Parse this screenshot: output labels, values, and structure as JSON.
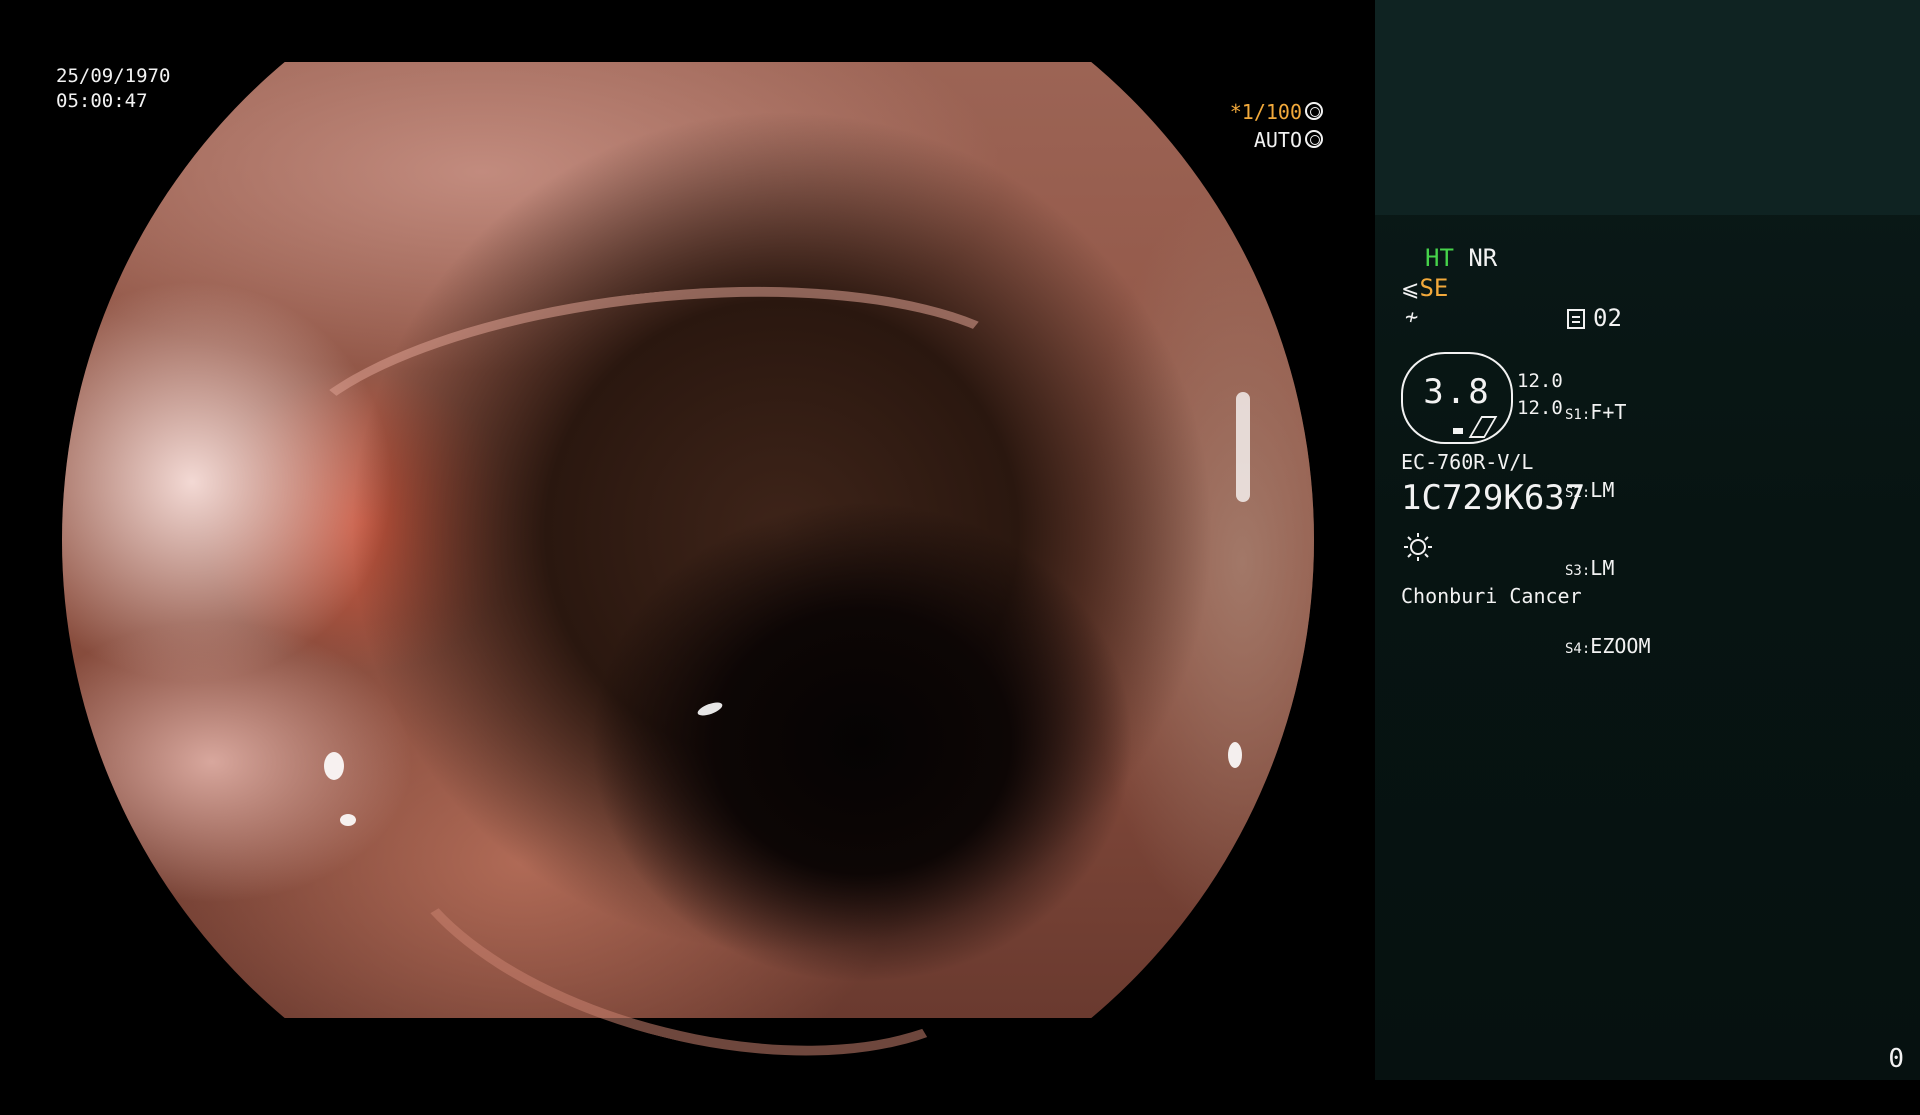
{
  "overlay": {
    "date": "25/09/1970",
    "time": "05:00:47",
    "shutter_speed": "*1/100",
    "iris_mode": "AUTO"
  },
  "panel": {
    "mode_ht": "HT",
    "mode_nr": "NR",
    "mode_se": "SE",
    "channel": "02",
    "gauge_value": "3.8",
    "gauge_side_1": "12.0",
    "gauge_side_2": "12.0",
    "switches": [
      {
        "key": "S1:",
        "value": "F+T"
      },
      {
        "key": "S2:",
        "value": "LM"
      },
      {
        "key": "S3:",
        "value": "LM"
      },
      {
        "key": "S4:",
        "value": "EZOOM"
      }
    ],
    "scope_model": "EC-760R-V/L",
    "scope_serial": "1C729K637",
    "hospital": "Chonburi Cancer",
    "counter": "0"
  },
  "colors": {
    "accent_orange": "#f2a93b",
    "accent_green": "#46d34b",
    "panel_bg": "#071412"
  },
  "icons": [
    "iris-icon",
    "shutter-icon",
    "structure-enhance-icon",
    "color-icon",
    "channel-icon",
    "light-source-icon"
  ]
}
